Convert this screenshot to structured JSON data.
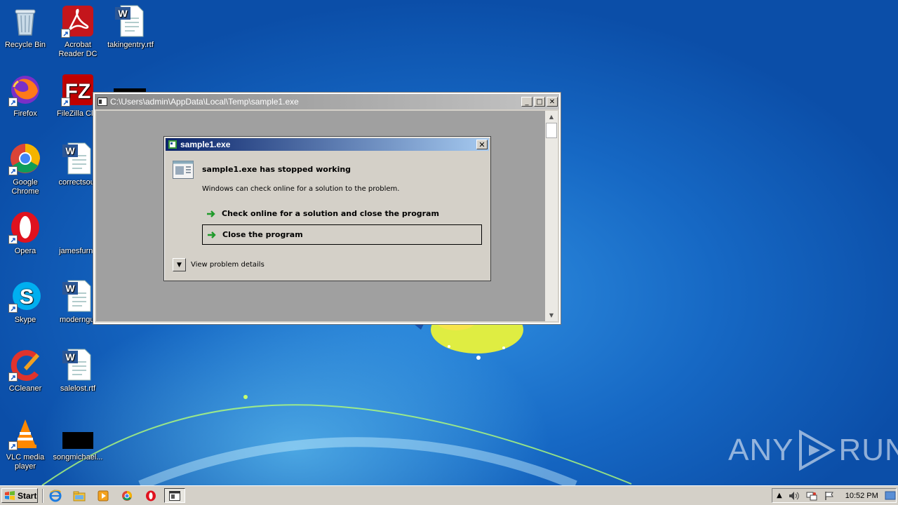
{
  "desktop": {
    "icons": [
      {
        "label": "Recycle Bin",
        "icon": "recycle-bin-icon"
      },
      {
        "label": "Acrobat Reader DC",
        "label_line1": "Acrobat",
        "label_line2": "Reader DC",
        "icon": "acrobat-icon"
      },
      {
        "label": "takingentry.rtf",
        "icon": "word-document-icon"
      },
      {
        "label": "Firefox",
        "icon": "firefox-icon"
      },
      {
        "label": "FileZilla Clie",
        "icon": "filezilla-icon"
      },
      {
        "label": "Google Chrome",
        "label_line1": "Google",
        "label_line2": "Chrome",
        "icon": "chrome-icon"
      },
      {
        "label": "correctsour",
        "icon": "word-document-icon"
      },
      {
        "label": "Opera",
        "icon": "opera-icon"
      },
      {
        "label": "jamesfurnit",
        "icon": "blank-file-icon"
      },
      {
        "label": "Skype",
        "icon": "skype-icon"
      },
      {
        "label": "moderngui",
        "icon": "word-document-icon"
      },
      {
        "label": "CCleaner",
        "icon": "ccleaner-icon"
      },
      {
        "label": "salelost.rtf",
        "icon": "word-document-icon"
      },
      {
        "label": "VLC media player",
        "label_line1": "VLC media",
        "label_line2": "player",
        "icon": "vlc-icon"
      },
      {
        "label": "songmichael...",
        "icon": "black-file-icon"
      }
    ]
  },
  "console_window": {
    "title": "C:\\Users\\admin\\AppData\\Local\\Temp\\sample1.exe",
    "minimize": "_",
    "maximize": "□",
    "close": "✕"
  },
  "error_dialog": {
    "title": "sample1.exe",
    "close": "✕",
    "heading": "sample1.exe has stopped working",
    "message": "Windows can check online for a solution to the problem.",
    "option_check_online": "Check online for a solution and close the program",
    "option_close": "Close the program",
    "details_label": "View problem details"
  },
  "watermark": {
    "left": "ANY",
    "right": "RUN"
  },
  "taskbar": {
    "start_label": "Start",
    "quick_launch": [
      "ie-icon",
      "explorer-icon",
      "media-player-icon",
      "chrome-icon",
      "opera-icon"
    ],
    "task_button_icon": "console-window-icon",
    "clock": "10:52 PM"
  },
  "colors": {
    "dialog_title_start": "#0a246a",
    "dialog_title_end": "#a6caf0",
    "arrow_green": "#1f9a2a",
    "desktop_blue": "#1668c4"
  }
}
